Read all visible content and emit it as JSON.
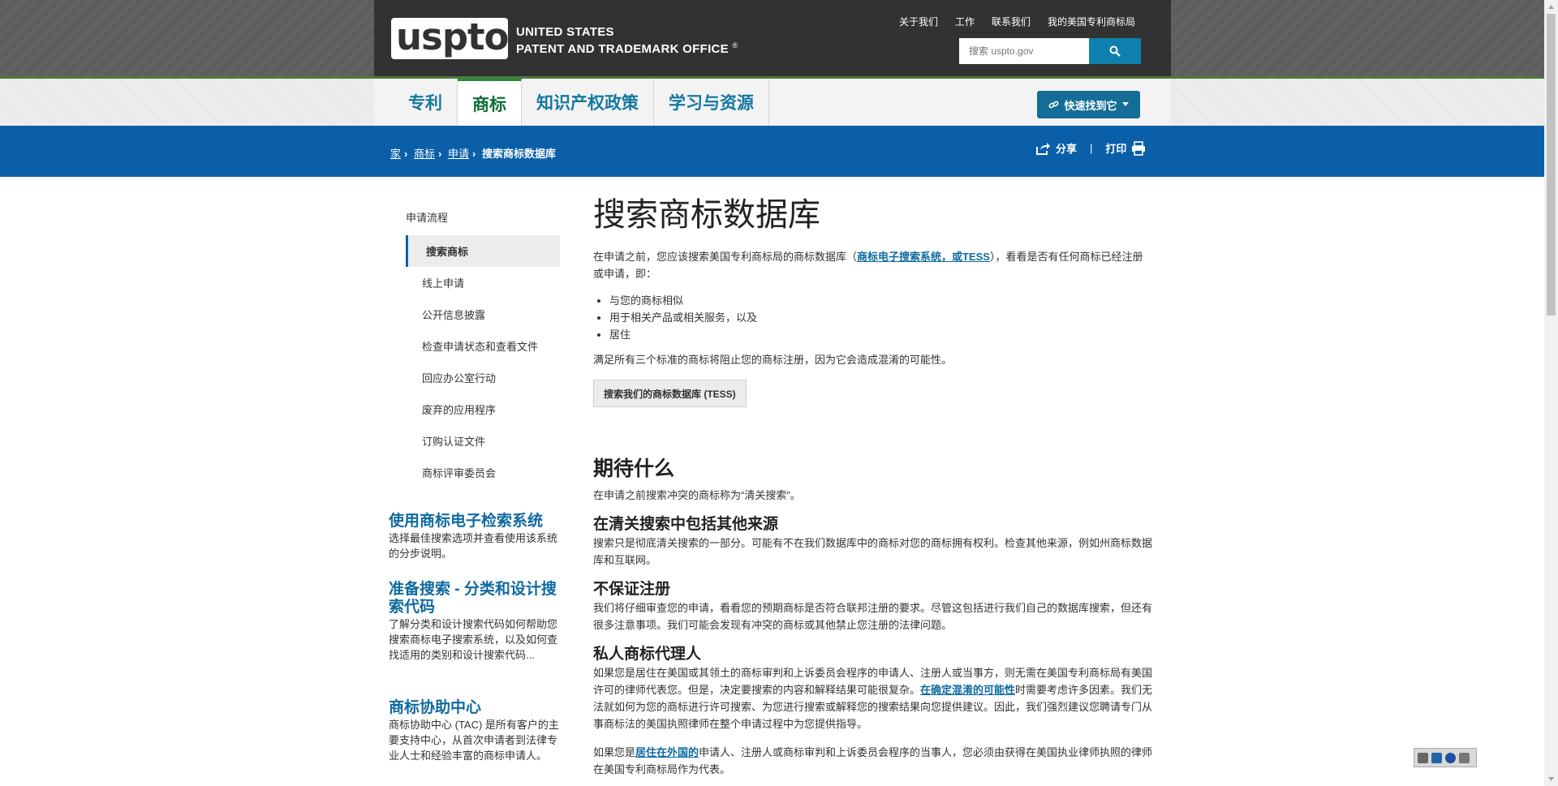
{
  "header": {
    "logo_text": "uspto",
    "org_line1": "UNITED STATES",
    "org_line2": "PATENT AND TRADEMARK OFFICE",
    "org_mark": "®",
    "util_links": [
      "关于我们",
      "工作",
      "联系我们",
      "我的美国专利商标局"
    ],
    "search_placeholder": "搜索 uspto.gov"
  },
  "nav": {
    "tabs": [
      "专利",
      "商标",
      "知识产权政策",
      "学习与资源"
    ],
    "active_tab": "商标",
    "quick_button": "快速找到它"
  },
  "breadcrumb": {
    "items": [
      "家",
      "商标",
      "申请"
    ],
    "current": "搜索商标数据库",
    "share": "分享",
    "print": "打印"
  },
  "sidebar": {
    "heading": "申请流程",
    "items": [
      "搜索商标",
      "线上申请",
      "公开信息披露",
      "检查申请状态和查看文件",
      "回应办公室行动",
      "废弃的应用程序",
      "订购认证文件",
      "商标评审委员会"
    ],
    "active_item": "搜索商标",
    "promos": [
      {
        "title": "使用商标电子检索系统",
        "text": "选择最佳搜索选项并查看使用该系统的分步说明。"
      },
      {
        "title": "准备搜索 - 分类和设计搜索代码",
        "text": "了解分类和设计搜索代码如何帮助您搜索商标电子搜索系统，以及如何查找适用的类别和设计搜索代码..."
      },
      {
        "title": "商标协助中心",
        "text": "商标协助中心 (TAC) 是所有客户的主要支持中心，从首次申请者到法律专业人士和经验丰富的商标申请人。"
      }
    ]
  },
  "main": {
    "title": "搜索商标数据库",
    "intro_before": "在申请之前，您应该搜索美国专利商标局的商标数据库（",
    "intro_link": "商标电子搜索系统，或TESS",
    "intro_after": "），看看是否有任何商标已经注册或申请，即：",
    "bullets": [
      "与您的商标相似",
      "用于相关产品或相关服务，以及",
      "居住"
    ],
    "criteria_text": "满足所有三个标准的商标将阻止您的商标注册，因为它会造成混淆的可能性。",
    "tess_button": "搜索我们的商标数据库 (TESS)",
    "h2_expect": "期待什么",
    "expect_text": "在申请之前搜索冲突的商标称为“清关搜索”。",
    "h4_sources": "在清关搜索中包括其他来源",
    "sources_text": "搜索只是彻底清关搜索的一部分。可能有不在我们数据库中的商标对您的商标拥有权利。检查其他来源，例如州商标数据库和互联网。",
    "h4_guarantee": "不保证注册",
    "guarantee_text": "我们将仔细审查您的申请，看看您的预期商标是否符合联邦注册的要求。尽管这包括进行我们自己的数据库搜索，但还有很多注意事项。我们可能会发现有冲突的商标或其他禁止您注册的法律问题。",
    "h4_attorney": "私人商标代理人",
    "attorney_before": "如果您是居住在美国或其领土的商标审判和上诉委员会程序的申请人、注册人或当事方，则无需在美国专利商标局有美国许可的律师代表您。但是，决定要搜索的内容和解释结果可能很复杂。",
    "attorney_link": "在确定混淆的可能性",
    "attorney_after": "时需要考虑许多因素。我们无法就如何为您的商标进行许可搜索、为您进行搜索或解释您的搜索结果向您提供建议。因此，我们强烈建议您聘请专门从事商标法的美国执照律师在整个申请过程中为您提供指导。",
    "foreign_before": "如果您是",
    "foreign_link": "居住在外国的",
    "foreign_after": "申请人、注册人或商标审判和上诉委员会程序的当事人，您必须由获得在美国执业律师执照的律师在美国专利商标局作为代表。"
  },
  "colors": {
    "header_dark": "#323232",
    "breadcrumb_blue": "#0b5fa8",
    "link_blue": "#0f6aa0",
    "active_green": "#0f6d3a"
  }
}
